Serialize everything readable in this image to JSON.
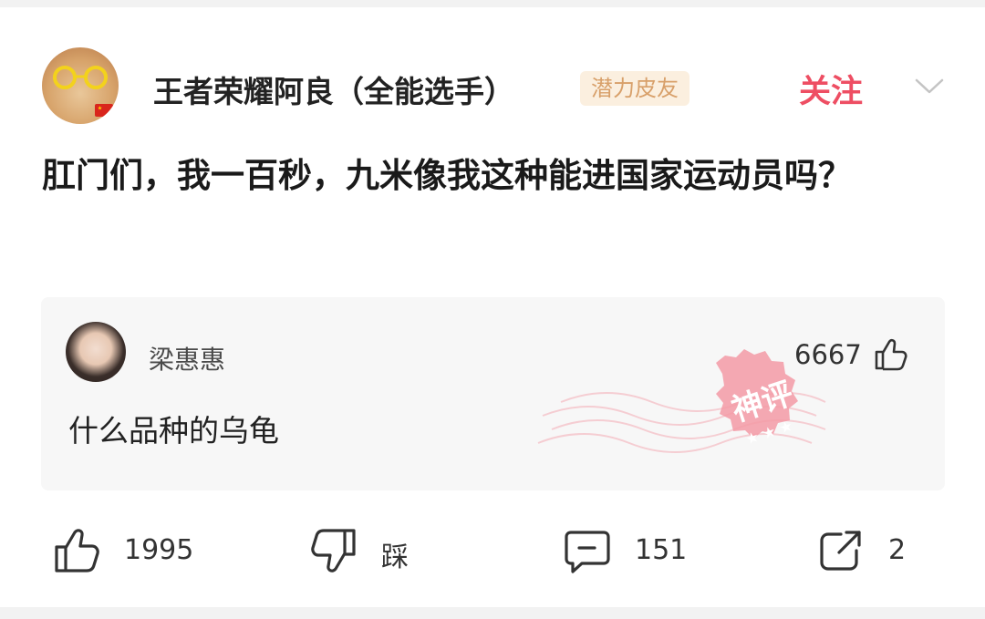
{
  "header": {
    "user_name": "王者荣耀阿良（全能选手）",
    "badge": "潜力皮友",
    "follow_label": "关注"
  },
  "post": {
    "text": "肛门们，我一百秒，九米像我这种能进国家运动员吗？"
  },
  "god_comment": {
    "user_name": "梁惠惠",
    "likes": "6667",
    "text": "什么品种的乌龟",
    "stamp_text": "神评"
  },
  "actions": {
    "like_count": "1995",
    "dislike_label": "踩",
    "comment_count": "151",
    "share_count": "2"
  },
  "colors": {
    "follow": "#ee4e63",
    "badge_text": "#d8a06a",
    "badge_bg": "#fbefdf",
    "stamp": "#f08a96"
  }
}
